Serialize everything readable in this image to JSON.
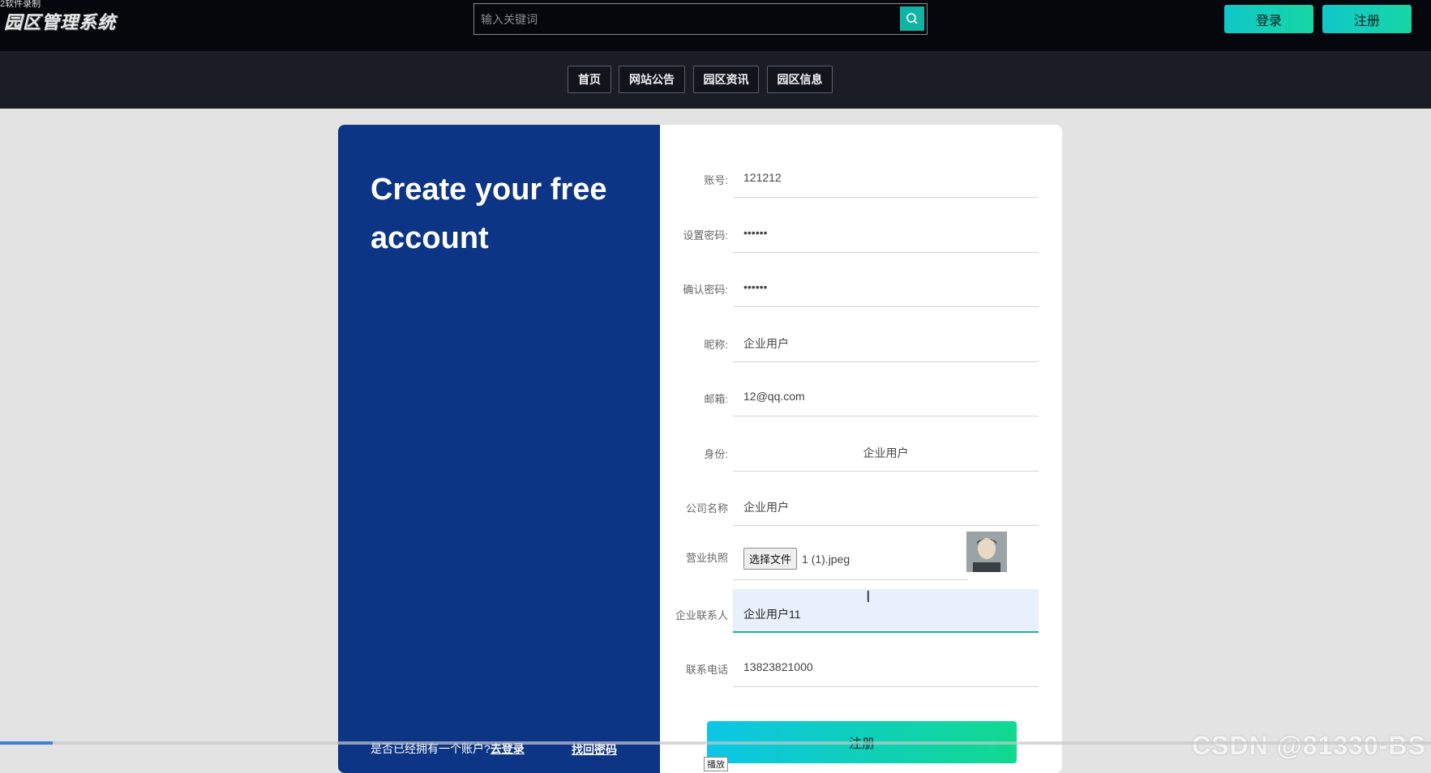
{
  "topbar": {
    "recording_mark": "2软件录制",
    "logo": "园区管理系统",
    "search_placeholder": "输入关键词",
    "login_label": "登录",
    "register_label": "注册"
  },
  "nav": {
    "items": [
      "首页",
      "网站公告",
      "园区资讯",
      "园区信息"
    ]
  },
  "card": {
    "headline": "Create your free account",
    "already_prompt": "是否已经拥有一个账户?",
    "go_login": "去登录",
    "find_password": "找回密码",
    "submit_label": "注册"
  },
  "form": {
    "fields": [
      {
        "label": "账号:",
        "value": "121212"
      },
      {
        "label": "设置密码:",
        "value": "••••••"
      },
      {
        "label": "确认密码:",
        "value": "••••••"
      },
      {
        "label": "昵称:",
        "value": "企业用户"
      },
      {
        "label": "邮箱:",
        "value": "12@qq.com"
      },
      {
        "label": "身份:",
        "value": "企业用户"
      },
      {
        "label": "公司名称",
        "value": "企业用户"
      },
      {
        "label": "营业执照",
        "file_button": "选择文件",
        "file_name": "1 (1).jpeg"
      },
      {
        "label": "企业联系人",
        "value": "企业用户11"
      },
      {
        "label": "联系电话",
        "value": "13823821000"
      }
    ]
  },
  "overlay": {
    "watermark": "CSDN @81330-BS",
    "play_tip": "播放"
  },
  "colors": {
    "left_panel": "#0d3585",
    "accent_gradient_start": "#0cc6e6",
    "accent_gradient_end": "#10d98f"
  }
}
